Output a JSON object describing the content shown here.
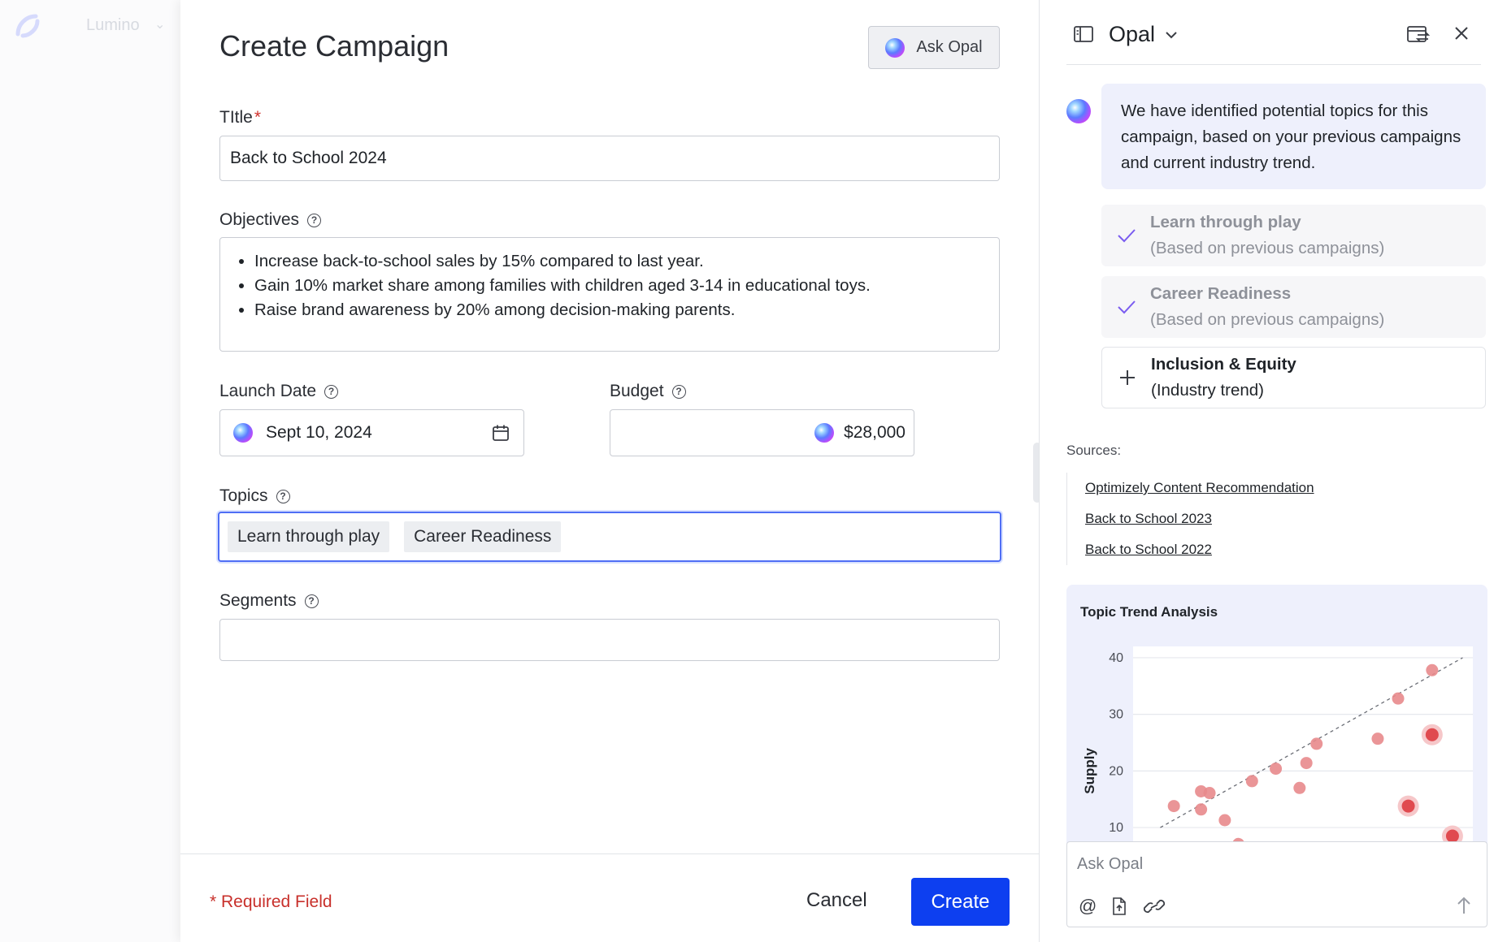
{
  "background_app": {
    "name": "Lumino"
  },
  "modal": {
    "title": "Create Campaign",
    "ask_opal_label": "Ask Opal",
    "fields": {
      "title": {
        "label": "TItle",
        "required_mark": "*",
        "value": "Back to School 2024"
      },
      "objectives": {
        "label": "Objectives",
        "items": [
          "Increase back-to-school sales by 15% compared to last year.",
          "Gain 10% market share among families with children aged 3-14 in educational toys.",
          "Raise brand awareness by 20% among decision-making parents."
        ]
      },
      "launch_date": {
        "label": "Launch Date",
        "value": "Sept 10, 2024"
      },
      "budget": {
        "label": "Budget",
        "value": "$28,000"
      },
      "topics": {
        "label": "Topics",
        "chips": [
          "Learn through play",
          "Career Readiness"
        ]
      },
      "segments": {
        "label": "Segments",
        "value": ""
      }
    },
    "footer": {
      "required_note": "* Required Field",
      "cancel_label": "Cancel",
      "create_label": "Create"
    }
  },
  "opal_panel": {
    "title": "Opal",
    "message": "We have identified potential topics for this campaign, based on your previous campaigns and current industry trend.",
    "topic_options": [
      {
        "name": "Learn through play",
        "note": "(Based on previous campaigns)",
        "state": "selected"
      },
      {
        "name": "Career Readiness",
        "note": "(Based on previous campaigns)",
        "state": "selected"
      },
      {
        "name": "Inclusion & Equity",
        "note": "(Industry trend)",
        "state": "add"
      }
    ],
    "sources_label": "Sources:",
    "sources": [
      "Optimizely Content Recommendation",
      "Back to School 2023",
      "Back to School 2022"
    ],
    "ask_placeholder": "Ask Opal"
  },
  "colors": {
    "primary": "#0d3ff0",
    "focus": "#4f6ef5",
    "required": "#c8302b",
    "panel_tint": "#eef0fc",
    "point": "#e8898c",
    "point_highlight": "#e04a4f"
  },
  "chart_data": {
    "type": "scatter",
    "title": "Topic Trend Analysis",
    "xlabel": "",
    "ylabel": "Supply",
    "y_ticks": [
      10,
      20,
      30,
      40
    ],
    "ylim": [
      7,
      42
    ],
    "xlim": [
      0,
      100
    ],
    "grid": true,
    "trendline": {
      "x": [
        8,
        97
      ],
      "y": [
        10,
        40
      ],
      "style": "dashed"
    },
    "series": [
      {
        "points": [
          {
            "x": 12,
            "y": 13.8
          },
          {
            "x": 20,
            "y": 16.4
          },
          {
            "x": 22.5,
            "y": 16.1
          },
          {
            "x": 20,
            "y": 13.2
          },
          {
            "x": 27,
            "y": 11.3
          },
          {
            "x": 35,
            "y": 18.2
          },
          {
            "x": 42,
            "y": 20.4
          },
          {
            "x": 49,
            "y": 17.0
          },
          {
            "x": 51,
            "y": 21.4
          },
          {
            "x": 54,
            "y": 24.8
          },
          {
            "x": 72,
            "y": 25.7
          },
          {
            "x": 78,
            "y": 32.8
          },
          {
            "x": 88,
            "y": 37.8
          },
          {
            "x": 31,
            "y": 7.1
          }
        ]
      },
      {
        "highlight": true,
        "points": [
          {
            "x": 88,
            "y": 26.4
          },
          {
            "x": 81,
            "y": 13.8
          },
          {
            "x": 94,
            "y": 8.5
          }
        ]
      }
    ]
  }
}
